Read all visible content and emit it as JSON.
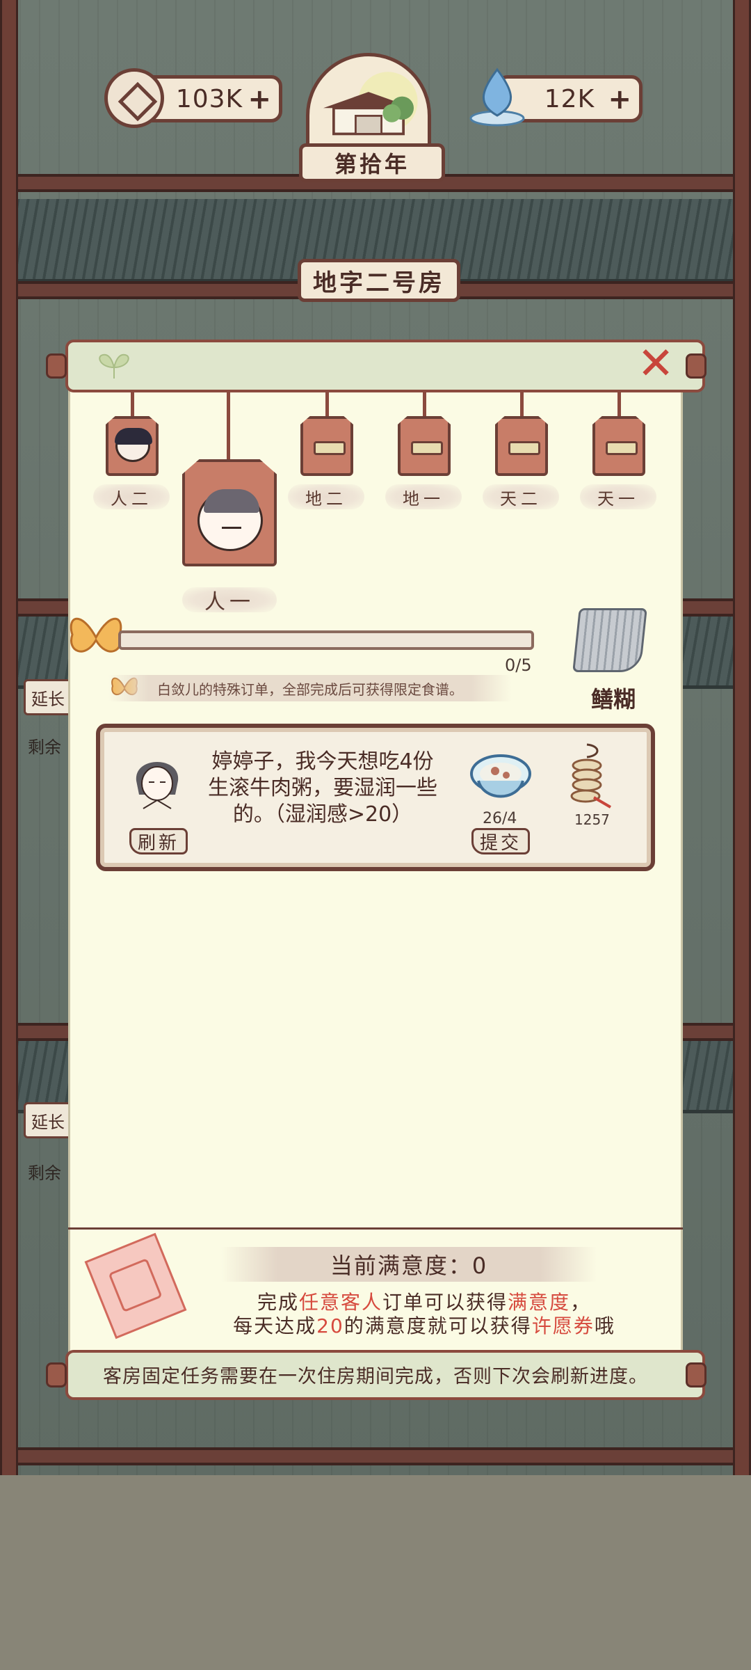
{
  "hud": {
    "coins": "103K",
    "water": "12K",
    "plus_symbol": "+",
    "year": "第拾年",
    "room_name": "地字二号房"
  },
  "background": {
    "side_tag_label": "延长",
    "side_remaining_label": "剩余"
  },
  "dialog": {
    "close_symbol": "✕",
    "tabs": [
      {
        "label": "人二"
      },
      {
        "label": "人一"
      },
      {
        "label": "地二"
      },
      {
        "label": "地一"
      },
      {
        "label": "天二"
      },
      {
        "label": "天一"
      }
    ],
    "progress": {
      "value": 0,
      "max": 5,
      "text": "0/5"
    },
    "hint": "白敛儿的特殊订单，全部完成后可获得限定食谱。",
    "reward_label": "鳝糊",
    "order": {
      "text": "婷婷子，我今天想吃4份生滚牛肉粥，要湿润一些的。（湿润感>20）",
      "refresh_label": "刷新",
      "submit_label": "提交",
      "dish_count": "26/4",
      "coin_reward": "1257"
    },
    "satisfaction": {
      "title": "当前满意度：0",
      "line1_a": "完成",
      "line1_hl1": "任意客人",
      "line1_b": "订单可以获得",
      "line1_hl2": "满意度",
      "line1_c": "，",
      "line2_a": "每天达成",
      "line2_hl1": "20",
      "line2_b": "的满意度就可以获得",
      "line2_hl2": "许愿券",
      "line2_c": "哦"
    },
    "footer": "客房固定任务需要在一次住房期间完成，否则下次会刷新进度。"
  },
  "colors": {
    "frame": "#6b3f36",
    "panel": "#fbfbe4",
    "highlight": "#d64a3e",
    "butterfly": "#f0b452"
  }
}
